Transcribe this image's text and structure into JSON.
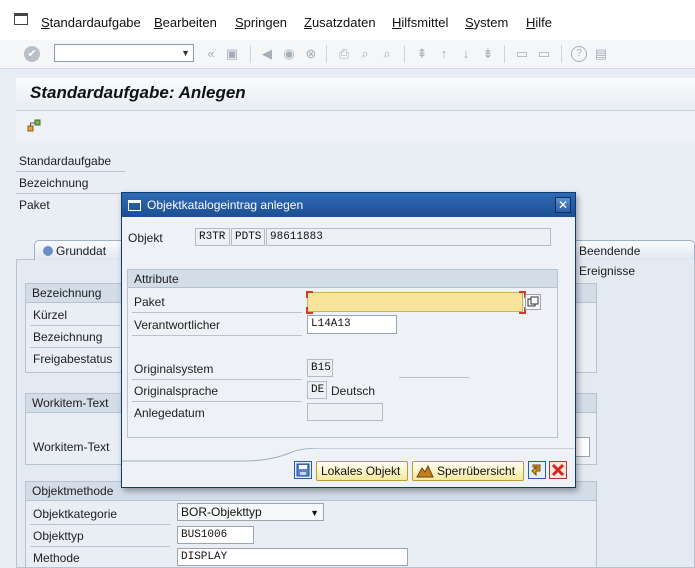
{
  "menubar": {
    "items": [
      "Standardaufgabe",
      "Bearbeiten",
      "Springen",
      "Zusatzdaten",
      "Hilfsmittel",
      "System",
      "Hilfe"
    ]
  },
  "page": {
    "title": "Standardaufgabe: Anlegen"
  },
  "header_fields": {
    "standardaufgabe_label": "Standardaufgabe",
    "bezeichnung_label": "Bezeichnung",
    "paket_label": "Paket"
  },
  "tabs": {
    "grunddaten_label": "Grunddat",
    "beendende_label": "Beendende Ereignisse"
  },
  "bezeichnung_group": {
    "title": "Bezeichnung",
    "kuerzel_label": "Kürzel",
    "bezeichnung_label": "Bezeichnung",
    "freigabestatus_label": "Freigabestatus"
  },
  "workitem_group": {
    "title": "Workitem-Text",
    "text_label": "Workitem-Text"
  },
  "objektmethode_group": {
    "title": "Objektmethode",
    "objektkategorie_label": "Objektkategorie",
    "objektkategorie_value": "BOR-Objekttyp",
    "objekttyp_label": "Objekttyp",
    "objekttyp_value": "BUS1006",
    "methode_label": "Methode",
    "methode_value": "DISPLAY"
  },
  "dialog": {
    "title": "Objektkatalogeintrag anlegen",
    "objekt_label": "Objekt",
    "objekt_pgmid": "R3TR",
    "objekt_type": "PDTS",
    "objekt_name": "98611883",
    "attribute_title": "Attribute",
    "paket_label": "Paket",
    "paket_value": "",
    "verantwortlicher_label": "Verantwortlicher",
    "verantwortlicher_value": "L14A13",
    "originalsystem_label": "Originalsystem",
    "originalsystem_value": "B15",
    "originalsprache_label": "Originalsprache",
    "originalsprache_value": "DE",
    "originalsprache_text": "Deutsch",
    "anlegedatum_label": "Anlegedatum",
    "anlegedatum_value": "",
    "lokales_objekt_label": "Lokales Objekt",
    "sperruebersicht_label": "Sperrübersicht"
  },
  "colors": {
    "dialog_title_bg": "#1c4f93",
    "required_field_bg": "#f8e49a",
    "button_bg": "#f4e99e"
  }
}
